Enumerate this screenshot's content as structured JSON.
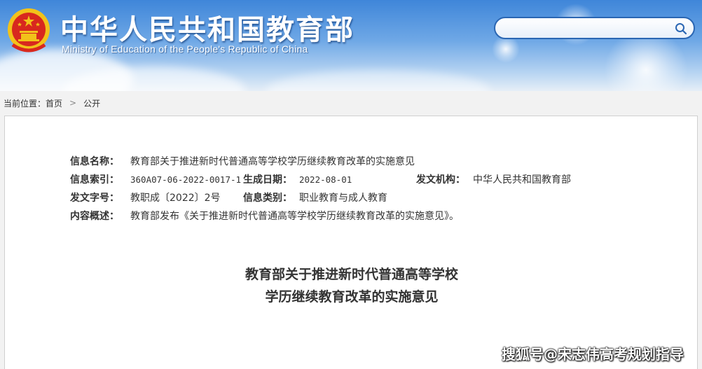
{
  "header": {
    "site_title_cn": "中华人民共和国教育部",
    "site_title_en": "Ministry of Education of the People's Republic of China",
    "search": {
      "placeholder": "",
      "value": ""
    }
  },
  "breadcrumb": {
    "prefix": "当前位置：",
    "items": [
      "首页",
      "公开"
    ]
  },
  "document_info": {
    "name_label": "信息名称：",
    "name_value": "教育部关于推进新时代普通高等学校学历继续教育改革的实施意见",
    "index_label": "信息索引：",
    "index_value": "360A07-06-2022-0017-1",
    "date_label": "生成日期：",
    "date_value": "2022-08-01",
    "issuer_label": "发文机构：",
    "issuer_value": "中华人民共和国教育部",
    "number_label": "发文字号：",
    "number_value": "教职成〔2022〕2号",
    "category_label": "信息类别：",
    "category_value": "职业教育与成人教育",
    "summary_label": "内容概述：",
    "summary_value": "教育部发布《关于推进新时代普通高等学校学历继续教育改革的实施意见》。"
  },
  "document": {
    "title_line1": "教育部关于推进新时代普通高等学校",
    "title_line2": "学历继续教育改革的实施意见"
  },
  "watermark": "搜狐号@宋志伟高考规划指导",
  "icons": {
    "emblem": "national-emblem-icon",
    "search": "search-icon",
    "separator": "chevron-right-icon"
  },
  "colors": {
    "header_blue": "#3f86d9",
    "search_border": "#2a66b3",
    "emblem_red": "#d8281e",
    "emblem_gold": "#f2c21a"
  }
}
